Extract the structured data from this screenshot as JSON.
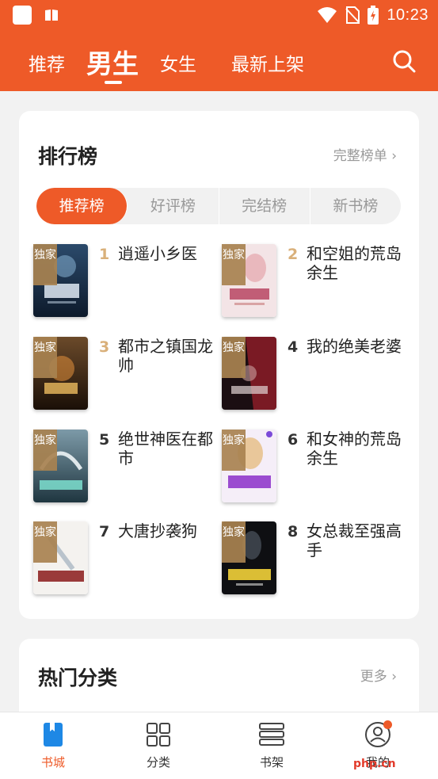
{
  "status_bar": {
    "time": "10:23"
  },
  "header": {
    "tabs": [
      {
        "label": "推荐"
      },
      {
        "label": "男生"
      },
      {
        "label": "女生"
      },
      {
        "label": "最新上架"
      }
    ],
    "active_tab": "男生"
  },
  "ranking": {
    "title": "排行榜",
    "more_label": "完整榜单 ›",
    "segments": [
      "推荐榜",
      "好评榜",
      "完结榜",
      "新书榜"
    ],
    "active_segment": "推荐榜",
    "badge_label": "独家",
    "books": [
      {
        "rank": "1",
        "title": "逍遥小乡医"
      },
      {
        "rank": "2",
        "title": "和空姐的荒岛余生"
      },
      {
        "rank": "3",
        "title": "都市之镇国龙帅"
      },
      {
        "rank": "4",
        "title": "我的绝美老婆"
      },
      {
        "rank": "5",
        "title": "绝世神医在都市"
      },
      {
        "rank": "6",
        "title": "和女神的荒岛余生"
      },
      {
        "rank": "7",
        "title": "大唐抄袭狗"
      },
      {
        "rank": "8",
        "title": "女总裁至强高手"
      }
    ]
  },
  "categories": {
    "title": "热门分类",
    "more_label": "更多 ›"
  },
  "bottom_nav": [
    {
      "label": "书城",
      "icon": "book-icon"
    },
    {
      "label": "分类",
      "icon": "grid-icon"
    },
    {
      "label": "书架",
      "icon": "shelf-icon"
    },
    {
      "label": "我的",
      "icon": "user-icon"
    }
  ],
  "watermark": "php.cn",
  "colors": {
    "accent": "#ee5a28",
    "rank_top": "#d9b07a",
    "badge": "#a88250"
  }
}
